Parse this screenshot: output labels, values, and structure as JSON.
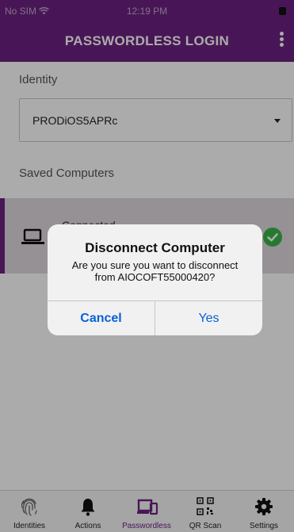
{
  "status_bar": {
    "carrier": "No SIM",
    "time": "12:19 PM"
  },
  "header": {
    "title": "PASSWORDLESS LOGIN",
    "menu_icon": "more-vertical-icon"
  },
  "identity": {
    "label": "Identity",
    "selected": "PRODiOS5APRc"
  },
  "saved_computers": {
    "label": "Saved Computers",
    "items": [
      {
        "status": "Connected",
        "icon": "laptop-icon",
        "status_icon": "check-circle-icon"
      }
    ]
  },
  "dialog": {
    "title": "Disconnect Computer",
    "message": "Are you sure you want to disconnect from AIOCOFT55000420?",
    "cancel_label": "Cancel",
    "confirm_label": "Yes"
  },
  "tabs": [
    {
      "label": "Identities",
      "icon": "fingerprint-icon",
      "active": false
    },
    {
      "label": "Actions",
      "icon": "bell-icon",
      "active": false
    },
    {
      "label": "Passwordless",
      "icon": "devices-icon",
      "active": true
    },
    {
      "label": "QR Scan",
      "icon": "qr-code-icon",
      "active": false
    },
    {
      "label": "Settings",
      "icon": "gear-icon",
      "active": false
    }
  ],
  "colors": {
    "brand": "#6c2280",
    "selected_row": "#ded8df",
    "success": "#3ab54a",
    "link": "#0a60d8"
  }
}
